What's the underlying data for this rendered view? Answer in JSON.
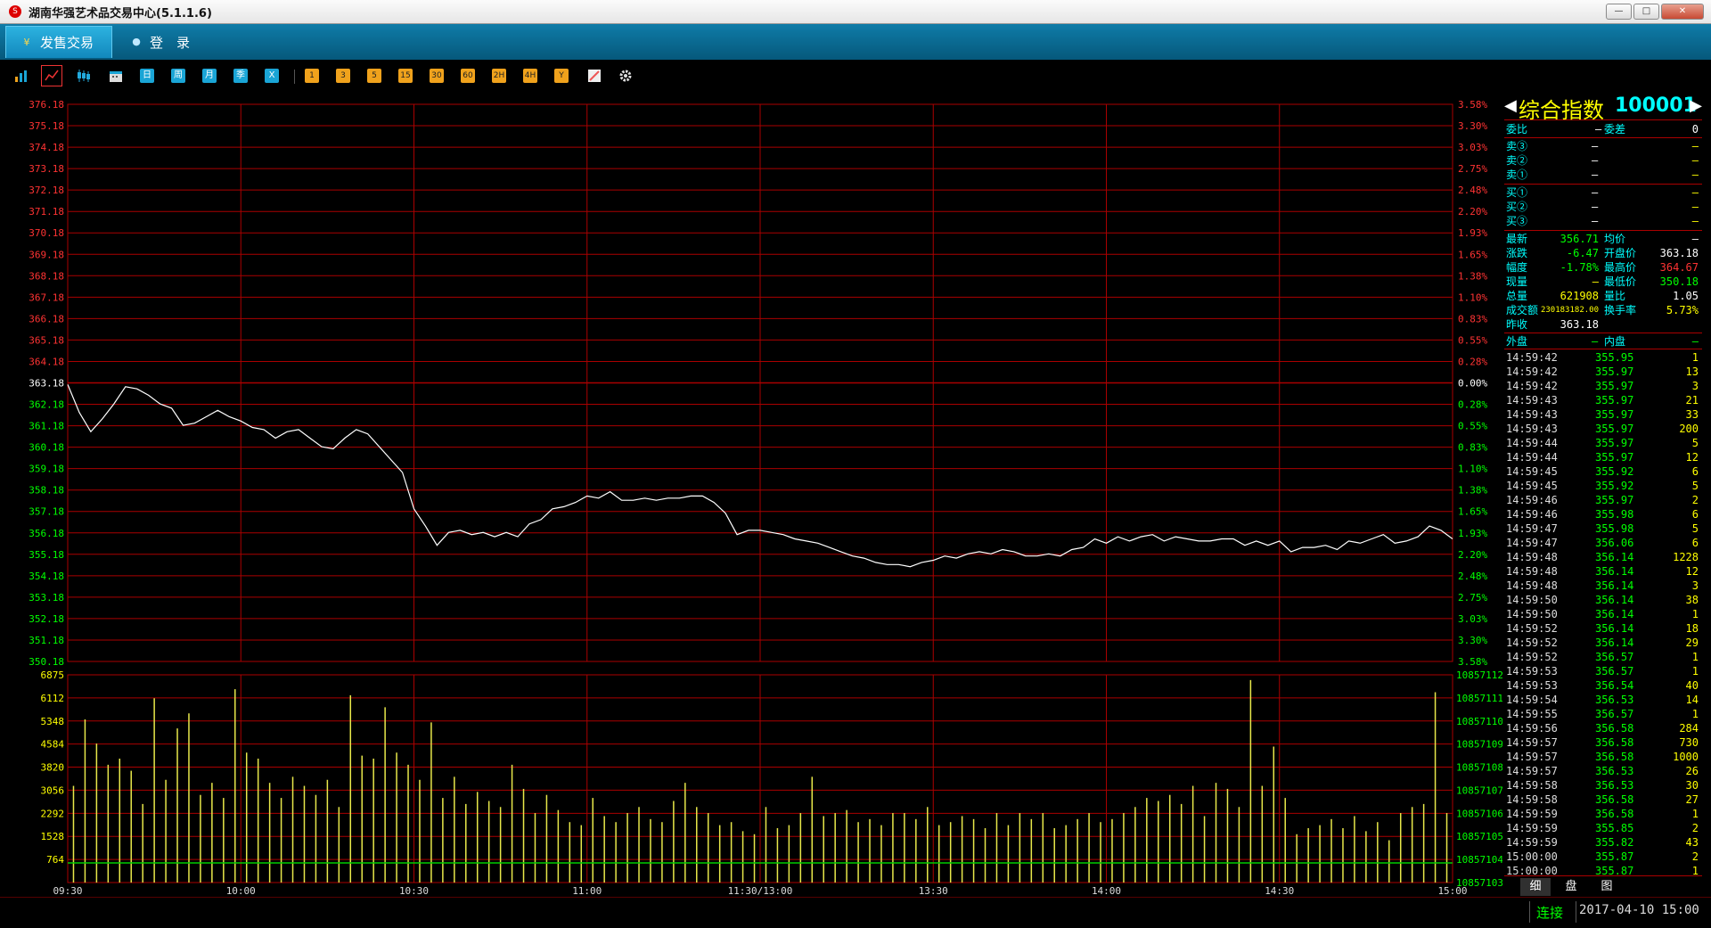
{
  "app": {
    "icon_label": "S",
    "title": "湖南华强艺术品交易中心(5.1.1.6)",
    "win_min": "—",
    "win_max": "□",
    "win_close": "✕"
  },
  "menu": {
    "tab1": {
      "icon": "¥",
      "label": "发售交易"
    },
    "tab2": {
      "icon": "●",
      "label": "登　录"
    }
  },
  "toolbar": {
    "chart_icons": [
      "bar-chart-icon",
      "line-chart-icon",
      "candle-chart-icon"
    ],
    "period_buttons": [
      "日",
      "周",
      "月",
      "季",
      "X"
    ],
    "minute_buttons": [
      "1",
      "3",
      "5",
      "15",
      "30",
      "60",
      "2H",
      "4H",
      "Y"
    ],
    "extra_icons": [
      "calendar-icon",
      "draw-icon",
      "gear-icon"
    ]
  },
  "chart_data": [
    {
      "type": "line",
      "name": "intraday-price",
      "base_price": 363.18,
      "ylim": [
        350.18,
        376.18
      ],
      "y_tick_labels": [
        "376.18",
        "375.18",
        "374.18",
        "373.18",
        "372.18",
        "371.18",
        "370.18",
        "369.18",
        "368.18",
        "367.18",
        "366.18",
        "365.18",
        "364.18",
        "363.18",
        "362.18",
        "361.18",
        "360.18",
        "359.18",
        "358.18",
        "357.18",
        "356.18",
        "355.18",
        "354.18",
        "353.18",
        "352.18",
        "351.18",
        "350.18"
      ],
      "pct_tick_labels": [
        "3.58%",
        "3.30%",
        "3.03%",
        "2.75%",
        "2.48%",
        "2.20%",
        "1.93%",
        "1.65%",
        "1.38%",
        "1.10%",
        "0.83%",
        "0.55%",
        "0.28%",
        "0.00%",
        "0.28%",
        "0.55%",
        "0.83%",
        "1.10%",
        "1.38%",
        "1.65%",
        "1.93%",
        "2.20%",
        "2.48%",
        "2.75%",
        "3.03%",
        "3.30%",
        "3.58%"
      ],
      "x_tick_labels": [
        "09:30",
        "10:00",
        "10:30",
        "11:00",
        "11:30/13:00",
        "13:30",
        "14:00",
        "14:30",
        "15:00"
      ],
      "x_minutes": [
        0,
        30,
        60,
        90,
        120,
        150,
        180,
        210,
        240
      ],
      "points": [
        [
          0,
          363.1
        ],
        [
          2,
          361.8
        ],
        [
          4,
          360.9
        ],
        [
          6,
          361.5
        ],
        [
          8,
          362.2
        ],
        [
          10,
          363.0
        ],
        [
          12,
          362.9
        ],
        [
          14,
          362.6
        ],
        [
          16,
          362.2
        ],
        [
          18,
          362.0
        ],
        [
          20,
          361.2
        ],
        [
          22,
          361.3
        ],
        [
          24,
          361.6
        ],
        [
          26,
          361.9
        ],
        [
          28,
          361.6
        ],
        [
          30,
          361.4
        ],
        [
          32,
          361.1
        ],
        [
          34,
          361.0
        ],
        [
          36,
          360.6
        ],
        [
          38,
          360.9
        ],
        [
          40,
          361.0
        ],
        [
          42,
          360.6
        ],
        [
          44,
          360.2
        ],
        [
          46,
          360.1
        ],
        [
          48,
          360.6
        ],
        [
          50,
          361.0
        ],
        [
          52,
          360.8
        ],
        [
          54,
          360.2
        ],
        [
          56,
          359.6
        ],
        [
          58,
          359.0
        ],
        [
          60,
          357.3
        ],
        [
          62,
          356.5
        ],
        [
          64,
          355.6
        ],
        [
          66,
          356.2
        ],
        [
          68,
          356.3
        ],
        [
          70,
          356.1
        ],
        [
          72,
          356.2
        ],
        [
          74,
          356.0
        ],
        [
          76,
          356.2
        ],
        [
          78,
          356.0
        ],
        [
          80,
          356.6
        ],
        [
          82,
          356.8
        ],
        [
          84,
          357.3
        ],
        [
          86,
          357.4
        ],
        [
          88,
          357.6
        ],
        [
          90,
          357.9
        ],
        [
          92,
          357.8
        ],
        [
          94,
          358.1
        ],
        [
          96,
          357.7
        ],
        [
          98,
          357.7
        ],
        [
          100,
          357.8
        ],
        [
          102,
          357.7
        ],
        [
          104,
          357.8
        ],
        [
          106,
          357.8
        ],
        [
          108,
          357.9
        ],
        [
          110,
          357.9
        ],
        [
          112,
          357.6
        ],
        [
          114,
          357.1
        ],
        [
          116,
          356.1
        ],
        [
          118,
          356.3
        ],
        [
          120,
          356.3
        ],
        [
          122,
          356.2
        ],
        [
          124,
          356.1
        ],
        [
          126,
          355.9
        ],
        [
          128,
          355.8
        ],
        [
          130,
          355.7
        ],
        [
          132,
          355.5
        ],
        [
          134,
          355.3
        ],
        [
          136,
          355.1
        ],
        [
          138,
          355.0
        ],
        [
          140,
          354.8
        ],
        [
          142,
          354.7
        ],
        [
          144,
          354.7
        ],
        [
          146,
          354.6
        ],
        [
          148,
          354.8
        ],
        [
          150,
          354.9
        ],
        [
          152,
          355.1
        ],
        [
          154,
          355.0
        ],
        [
          156,
          355.2
        ],
        [
          158,
          355.3
        ],
        [
          160,
          355.2
        ],
        [
          162,
          355.4
        ],
        [
          164,
          355.3
        ],
        [
          166,
          355.1
        ],
        [
          168,
          355.1
        ],
        [
          170,
          355.2
        ],
        [
          172,
          355.1
        ],
        [
          174,
          355.4
        ],
        [
          176,
          355.5
        ],
        [
          178,
          355.9
        ],
        [
          180,
          355.7
        ],
        [
          182,
          356.0
        ],
        [
          184,
          355.8
        ],
        [
          186,
          356.0
        ],
        [
          188,
          356.1
        ],
        [
          190,
          355.8
        ],
        [
          192,
          356.0
        ],
        [
          194,
          355.9
        ],
        [
          196,
          355.8
        ],
        [
          198,
          355.8
        ],
        [
          200,
          355.9
        ],
        [
          202,
          355.9
        ],
        [
          204,
          355.6
        ],
        [
          206,
          355.8
        ],
        [
          208,
          355.6
        ],
        [
          210,
          355.8
        ],
        [
          212,
          355.3
        ],
        [
          214,
          355.5
        ],
        [
          216,
          355.5
        ],
        [
          218,
          355.6
        ],
        [
          220,
          355.4
        ],
        [
          222,
          355.8
        ],
        [
          224,
          355.7
        ],
        [
          226,
          355.9
        ],
        [
          228,
          356.1
        ],
        [
          230,
          355.7
        ],
        [
          232,
          355.8
        ],
        [
          234,
          356.0
        ],
        [
          236,
          356.5
        ],
        [
          238,
          356.3
        ],
        [
          240,
          355.9
        ]
      ]
    },
    {
      "type": "bar",
      "name": "intraday-volume",
      "ylim": [
        0,
        6875
      ],
      "y_tick_labels": [
        "6875",
        "6112",
        "5348",
        "4584",
        "3820",
        "3056",
        "2292",
        "1528",
        "764"
      ],
      "y_tick_values": [
        6875,
        6112,
        5348,
        4584,
        3820,
        3056,
        2292,
        1528,
        764
      ],
      "right_tick_labels": [
        "10857112",
        "10857111",
        "10857110",
        "10857109",
        "10857108",
        "10857107",
        "10857106",
        "10857105",
        "10857104",
        "10857103"
      ],
      "bars": [
        [
          1,
          3200
        ],
        [
          3,
          5400
        ],
        [
          5,
          4600
        ],
        [
          7,
          3900
        ],
        [
          9,
          4100
        ],
        [
          11,
          3700
        ],
        [
          13,
          2600
        ],
        [
          15,
          6100
        ],
        [
          17,
          3400
        ],
        [
          19,
          5100
        ],
        [
          21,
          5600
        ],
        [
          23,
          2900
        ],
        [
          25,
          3300
        ],
        [
          27,
          2800
        ],
        [
          29,
          6400
        ],
        [
          31,
          4300
        ],
        [
          33,
          4100
        ],
        [
          35,
          3300
        ],
        [
          37,
          2800
        ],
        [
          39,
          3500
        ],
        [
          41,
          3200
        ],
        [
          43,
          2900
        ],
        [
          45,
          3400
        ],
        [
          47,
          2500
        ],
        [
          49,
          6200
        ],
        [
          51,
          4200
        ],
        [
          53,
          4100
        ],
        [
          55,
          5800
        ],
        [
          57,
          4300
        ],
        [
          59,
          3900
        ],
        [
          61,
          3400
        ],
        [
          63,
          5300
        ],
        [
          65,
          2800
        ],
        [
          67,
          3500
        ],
        [
          69,
          2600
        ],
        [
          71,
          3000
        ],
        [
          73,
          2700
        ],
        [
          75,
          2500
        ],
        [
          77,
          3900
        ],
        [
          79,
          3100
        ],
        [
          81,
          2300
        ],
        [
          83,
          2900
        ],
        [
          85,
          2400
        ],
        [
          87,
          2000
        ],
        [
          89,
          1900
        ],
        [
          91,
          2800
        ],
        [
          93,
          2200
        ],
        [
          95,
          2000
        ],
        [
          97,
          2300
        ],
        [
          99,
          2500
        ],
        [
          101,
          2100
        ],
        [
          103,
          2000
        ],
        [
          105,
          2700
        ],
        [
          107,
          3300
        ],
        [
          109,
          2500
        ],
        [
          111,
          2300
        ],
        [
          113,
          1900
        ],
        [
          115,
          2000
        ],
        [
          117,
          1700
        ],
        [
          119,
          1600
        ],
        [
          121,
          2500
        ],
        [
          123,
          1800
        ],
        [
          125,
          1900
        ],
        [
          127,
          2300
        ],
        [
          129,
          3500
        ],
        [
          131,
          2200
        ],
        [
          133,
          2300
        ],
        [
          135,
          2400
        ],
        [
          137,
          2000
        ],
        [
          139,
          2100
        ],
        [
          141,
          1900
        ],
        [
          143,
          2300
        ],
        [
          145,
          2300
        ],
        [
          147,
          2100
        ],
        [
          149,
          2500
        ],
        [
          151,
          1900
        ],
        [
          153,
          2000
        ],
        [
          155,
          2200
        ],
        [
          157,
          2100
        ],
        [
          159,
          1800
        ],
        [
          161,
          2300
        ],
        [
          163,
          1900
        ],
        [
          165,
          2300
        ],
        [
          167,
          2100
        ],
        [
          169,
          2300
        ],
        [
          171,
          1800
        ],
        [
          173,
          1900
        ],
        [
          175,
          2100
        ],
        [
          177,
          2300
        ],
        [
          179,
          2000
        ],
        [
          181,
          2100
        ],
        [
          183,
          2300
        ],
        [
          185,
          2500
        ],
        [
          187,
          2800
        ],
        [
          189,
          2700
        ],
        [
          191,
          2900
        ],
        [
          193,
          2600
        ],
        [
          195,
          3200
        ],
        [
          197,
          2200
        ],
        [
          199,
          3300
        ],
        [
          201,
          3100
        ],
        [
          203,
          2500
        ],
        [
          205,
          6700
        ],
        [
          207,
          3200
        ],
        [
          209,
          4500
        ],
        [
          211,
          2800
        ],
        [
          213,
          1600
        ],
        [
          215,
          1800
        ],
        [
          217,
          1900
        ],
        [
          219,
          2100
        ],
        [
          221,
          1800
        ],
        [
          223,
          2200
        ],
        [
          225,
          1700
        ],
        [
          227,
          2000
        ],
        [
          229,
          1400
        ],
        [
          231,
          2300
        ],
        [
          233,
          2500
        ],
        [
          235,
          2600
        ],
        [
          237,
          6300
        ],
        [
          239,
          2300
        ]
      ]
    }
  ],
  "quote": {
    "name": "综合指数",
    "code": "100001",
    "weibi_label": "委比",
    "weibi_value": "—",
    "weicha_label": "委差",
    "weicha_value": "0",
    "sell": [
      {
        "label": "卖③",
        "price": "—",
        "vol": "—"
      },
      {
        "label": "卖②",
        "price": "—",
        "vol": "—"
      },
      {
        "label": "卖①",
        "price": "—",
        "vol": "—"
      }
    ],
    "buy": [
      {
        "label": "买①",
        "price": "—",
        "vol": "—"
      },
      {
        "label": "买②",
        "price": "—",
        "vol": "—"
      },
      {
        "label": "买③",
        "price": "—",
        "vol": "—"
      }
    ],
    "stats": [
      {
        "l1": "最新",
        "v1": "356.71",
        "c1": "#0f0",
        "l2": "均价",
        "v2": "—",
        "c2": "#fff"
      },
      {
        "l1": "涨跌",
        "v1": "-6.47",
        "c1": "#0f0",
        "l2": "开盘价",
        "v2": "363.18",
        "c2": "#fff"
      },
      {
        "l1": "幅度",
        "v1": "-1.78%",
        "c1": "#0f0",
        "l2": "最高价",
        "v2": "364.67",
        "c2": "#f33"
      },
      {
        "l1": "现量",
        "v1": "—",
        "c1": "#ff0",
        "l2": "最低价",
        "v2": "350.18",
        "c2": "#0f0"
      },
      {
        "l1": "总量",
        "v1": "621908",
        "c1": "#ff0",
        "l2": "量比",
        "v2": "1.05",
        "c2": "#fff"
      },
      {
        "l1": "成交额",
        "v1": "230183182.00",
        "c1": "#ff0",
        "l2": "换手率",
        "v2": "5.73%",
        "c2": "#ff0"
      },
      {
        "l1": "昨收",
        "v1": "363.18",
        "c1": "#fff",
        "l2": "",
        "v2": "",
        "c2": "#fff"
      }
    ],
    "outer_label": "外盘",
    "outer_value": "—",
    "inner_label": "内盘",
    "inner_value": "—"
  },
  "ticks": [
    [
      "14:59:42",
      "355.95",
      "1"
    ],
    [
      "14:59:42",
      "355.97",
      "13"
    ],
    [
      "14:59:42",
      "355.97",
      "3"
    ],
    [
      "14:59:43",
      "355.97",
      "21"
    ],
    [
      "14:59:43",
      "355.97",
      "33"
    ],
    [
      "14:59:43",
      "355.97",
      "200"
    ],
    [
      "14:59:44",
      "355.97",
      "5"
    ],
    [
      "14:59:44",
      "355.97",
      "12"
    ],
    [
      "14:59:45",
      "355.92",
      "6"
    ],
    [
      "14:59:45",
      "355.92",
      "5"
    ],
    [
      "14:59:46",
      "355.97",
      "2"
    ],
    [
      "14:59:46",
      "355.98",
      "6"
    ],
    [
      "14:59:47",
      "355.98",
      "5"
    ],
    [
      "14:59:47",
      "356.06",
      "6"
    ],
    [
      "14:59:48",
      "356.14",
      "1228"
    ],
    [
      "14:59:48",
      "356.14",
      "12"
    ],
    [
      "14:59:48",
      "356.14",
      "3"
    ],
    [
      "14:59:50",
      "356.14",
      "38"
    ],
    [
      "14:59:50",
      "356.14",
      "1"
    ],
    [
      "14:59:52",
      "356.14",
      "18"
    ],
    [
      "14:59:52",
      "356.14",
      "29"
    ],
    [
      "14:59:52",
      "356.57",
      "1"
    ],
    [
      "14:59:53",
      "356.57",
      "1"
    ],
    [
      "14:59:53",
      "356.54",
      "40"
    ],
    [
      "14:59:54",
      "356.53",
      "14"
    ],
    [
      "14:59:55",
      "356.57",
      "1"
    ],
    [
      "14:59:56",
      "356.58",
      "284"
    ],
    [
      "14:59:57",
      "356.58",
      "730"
    ],
    [
      "14:59:57",
      "356.58",
      "1000"
    ],
    [
      "14:59:57",
      "356.53",
      "26"
    ],
    [
      "14:59:58",
      "356.53",
      "30"
    ],
    [
      "14:59:58",
      "356.58",
      "27"
    ],
    [
      "14:59:59",
      "356.58",
      "1"
    ],
    [
      "14:59:59",
      "355.85",
      "2"
    ],
    [
      "14:59:59",
      "355.82",
      "43"
    ],
    [
      "15:00:00",
      "355.87",
      "2"
    ],
    [
      "15:00:00",
      "355.87",
      "1"
    ]
  ],
  "tabs": [
    "细",
    "盘",
    "图"
  ],
  "status": {
    "connection": "连接",
    "datetime": "2017-04-10 15:00"
  }
}
